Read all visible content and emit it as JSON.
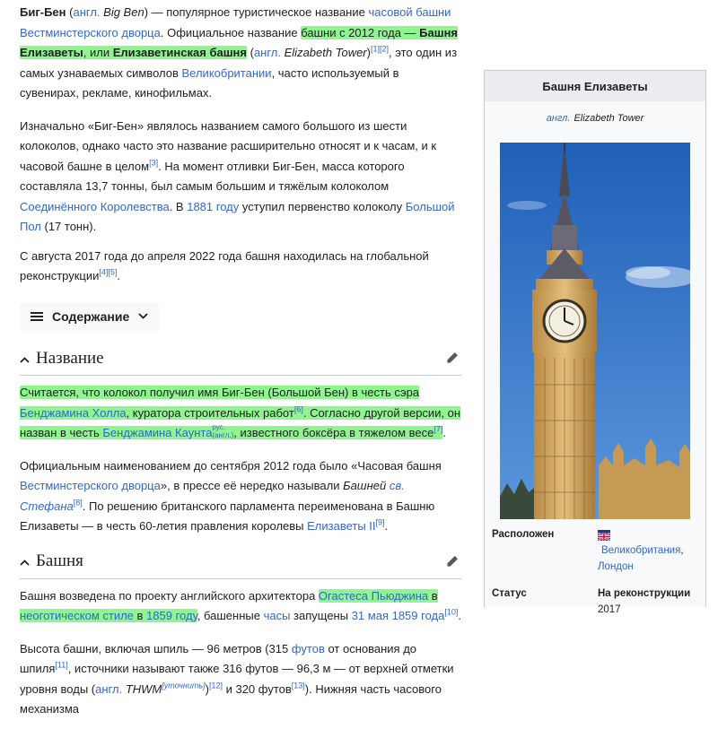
{
  "intro": {
    "p1": {
      "t1": "Биг-Бен",
      "t2": " (",
      "lang": "англ.",
      "t3": " ",
      "en": "Big Ben",
      "t4": ") — популярное туристическое название ",
      "link1": "часовой башни Вестминстерского дворца",
      "t5": ". Официальное название ",
      "hl1": "башни с 2012 года — ",
      "hl1b": "Башня Елизаветы",
      "hl1c": ", или ",
      "hl1d": "Елизаветинская башня",
      "t6": " (",
      "lang2": "англ.",
      "t7": " ",
      "en2": "Elizabeth Tower",
      "t8": ")",
      "ref1": "[1][2]",
      "t9": ", это один из самых узнаваемых символов ",
      "link2": "Великобритании",
      "t10": ", часто используемый в сувенирах, рекламе, кинофильмах."
    },
    "p2": {
      "t1": "Изначально «Биг-Бен» являлось названием самого большого из шести колоколов, однако часто это название расширительно относят и к часам, и к часовой башне в целом",
      "ref1": "[3]",
      "t2": ". На момент отливки Биг-Бен, масса которого составляла 13,7 тонны, был самым большим и тяжёлым колоколом ",
      "link1": "Соединённого Королевства",
      "t3": ". В ",
      "link2": "1881 году",
      "t4": " уступил первенство колоколу ",
      "link3": "Большой Пол",
      "t5": " (17 тонн)."
    },
    "p3": {
      "t1": "С августа 2017 года до апреля 2022 года башня находилась на глобальной реконструкции",
      "ref1": "[4][5]",
      "t2": "."
    }
  },
  "toc": {
    "label": "Содержание"
  },
  "section1": {
    "title": "Название",
    "p1": {
      "hl1": "Считается, что колокол получил имя Биг-Бен (Большой Бен) в честь сэра ",
      "link1": "Бенджамина Холла",
      "hl2": ", куратора строительных работ",
      "ref1": "[6]",
      "hl3": ". Согласно другой версии, он назван в честь ",
      "link2": "Бенджамина Каунта",
      "rus": "рус.",
      "angl": "(англ.)",
      "hl4": ", известного боксёра в тяжелом весе",
      "ref2": "[7]",
      "t1": "."
    },
    "p2": {
      "t1": "Официальным наименованием до сентября 2012 года было «Часовая башня ",
      "link1": "Вестминстерского дворца",
      "t2": "», в прессе её нередко называли ",
      "it1": "Башней ",
      "link2": "св. Стефана",
      "ref1": "[8]",
      "t3": ". По решению британского парламента переименована в Башню Елизаветы — в честь 60-летия правления королевы ",
      "link3": "Елизаветы II",
      "ref2": "[9]",
      "t4": "."
    }
  },
  "section2": {
    "title": "Башня",
    "p1": {
      "t1": "Башня возведена по проекту английского архитектора ",
      "link1": "Огастеса Пьюджина",
      "hl1": " в ",
      "link2": "неоготическом стиле",
      "hl2": " в ",
      "link3": "1859 году",
      "t2": ", башенные ",
      "link4": "часы",
      "t3": " запущены ",
      "link5": "31 мая 1859 года",
      "ref1": "[10]",
      "t4": "."
    },
    "p2": {
      "t1": "Высота башни, включая шпиль — 96 метров (315 ",
      "link1": "футов",
      "t2": " от основания до шпиля",
      "ref1": "[11]",
      "t3": ", источники называют также 316 футов — 96,3 м — от верхней отметки уровня воды (",
      "lang": "англ.",
      "t4": " ",
      "it1": "THWM",
      "utoch": "[уточнить]",
      "t5": ")",
      "ref2": "[12]",
      "t6": " и 320 футов",
      "ref3": "[13]",
      "t7": "). Нижняя часть часового механизма"
    }
  },
  "infobox": {
    "title": "Башня Елизаветы",
    "sub_lang": "англ.",
    "sub_name": "Elizabeth Tower",
    "rows": [
      {
        "key": "Расположен",
        "v1": "Великобритания",
        "v1_tail": ",",
        "v2": "Лондон"
      },
      {
        "key": "Статус",
        "v1": "На реконструкции",
        "v2": "2017"
      }
    ]
  },
  "colors": {
    "link": "#3366cc",
    "highlight": "#8ff58f",
    "text": "#202122"
  }
}
